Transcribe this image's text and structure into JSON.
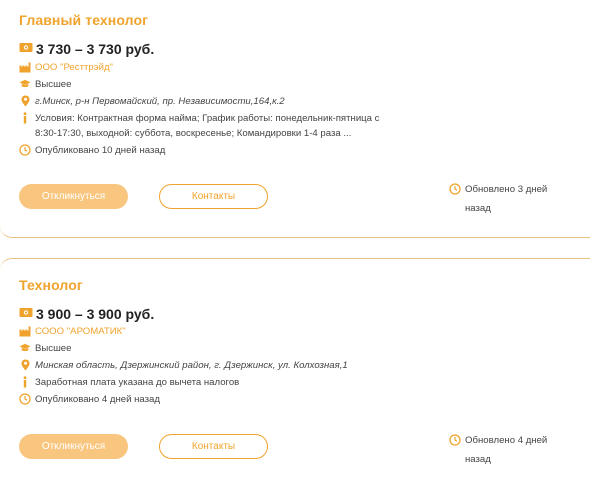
{
  "colors": {
    "accent": "#f0a32c",
    "button_fill": "#f9c67f",
    "border": "#e7c17f"
  },
  "vacancies": [
    {
      "title": "Главный технолог",
      "salary": "3 730 – 3 730 руб.",
      "company": "ООО \"Ресттрэйд\"",
      "education": "Высшее",
      "address": "г.Минск, р-н Первомайский, пр. Независимости,164,к.2",
      "info": "Условия: Контрактная форма найма; График работы: понедельник-пятница с 8:30-17:30, выходной: суббота, воскресенье; Командировки 1-4 раза ...",
      "published": "Опубликовано 10 дней назад",
      "apply_label": "Откликнуться",
      "contacts_label": "Контакты",
      "updated": "Обновлено 3 дней назад"
    },
    {
      "title": "Технолог",
      "salary": "3 900 – 3 900 руб.",
      "company": "СООО \"АРОМАТИК\"",
      "education": "Высшее",
      "address": "Минская область, Дзержинский район, г. Дзержинск, ул. Колхозная,1",
      "info": "Заработная плата указана до вычета налогов",
      "published": "Опубликовано 4 дней назад",
      "apply_label": "Откликнуться",
      "contacts_label": "Контакты",
      "updated": "Обновлено 4 дней назад"
    }
  ],
  "icons": [
    "money-icon",
    "factory-icon",
    "graduation-cap-icon",
    "location-pin-icon",
    "info-icon",
    "clock-icon"
  ]
}
